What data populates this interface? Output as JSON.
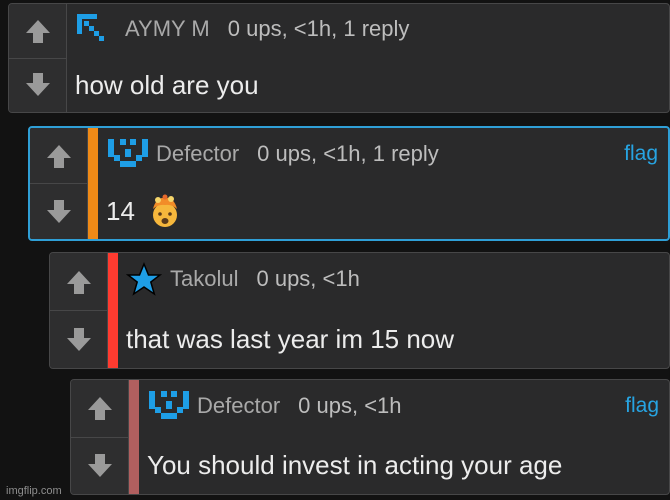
{
  "comments": [
    {
      "username": "AYMY  M",
      "meta": "0 ups, <1h, 1 reply",
      "text": "how old are you",
      "flag": ""
    },
    {
      "username": "Defector",
      "meta": "0 ups, <1h, 1 reply",
      "text": "14",
      "flag": "flag"
    },
    {
      "username": "Takolul",
      "meta": "0 ups, <1h",
      "text": "that was last year im 15 now",
      "flag": ""
    },
    {
      "username": "Defector",
      "meta": "0 ups, <1h",
      "text": "You should invest in acting your age",
      "flag": "flag"
    }
  ],
  "colors": {
    "bar_reply_1": "#ef8a17",
    "bar_reply_2": "#ff3b30",
    "bar_reply_3": "#b15f5f",
    "accent": "#27a4e2"
  },
  "icons": {
    "upvote": "arrow-up-icon",
    "downvote": "arrow-down-icon",
    "avatar_aymy": "pixel-arrow-avatar-icon",
    "avatar_defector": "pixel-v-avatar-icon",
    "avatar_takolul": "blue-star-icon",
    "emoji": "exploding-head-emoji"
  },
  "watermark": "imgflip.com"
}
